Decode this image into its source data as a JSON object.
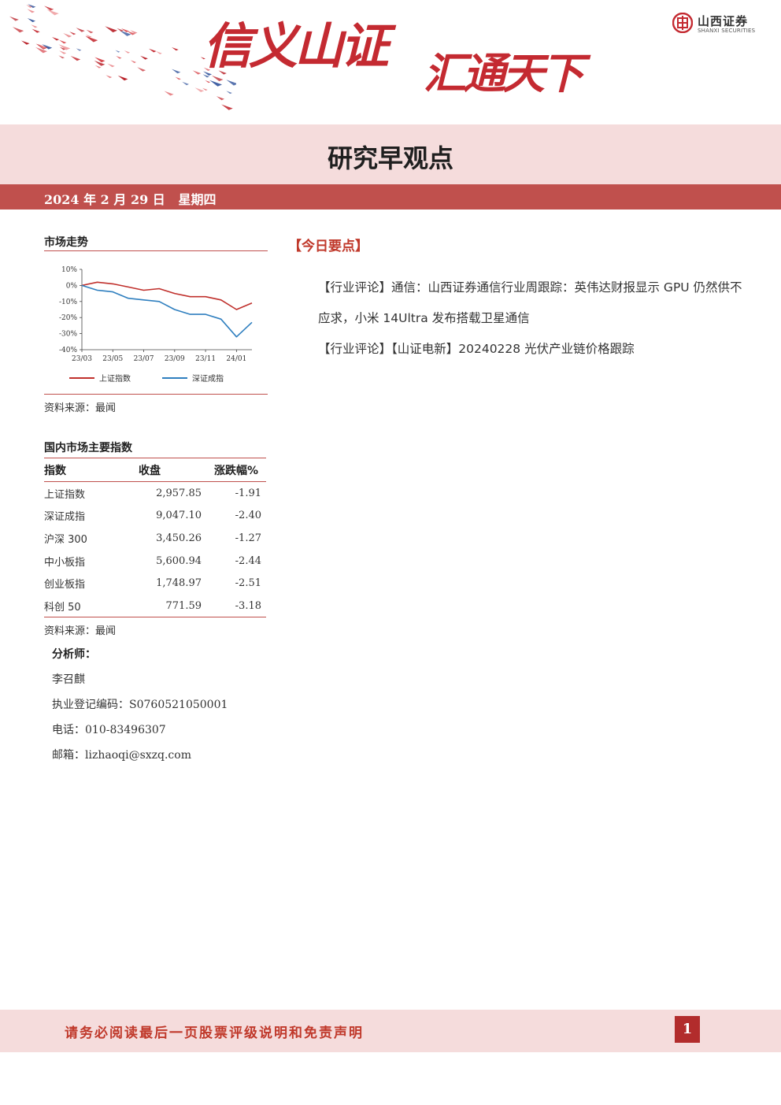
{
  "header": {
    "slogan_part1": "信义山证",
    "slogan_part2": "汇通天下",
    "logo_cn": "山西证券",
    "logo_en": "SHANXI SECURITIES",
    "report_title": "研究早观点",
    "date": "2024 年 2 月 29 日",
    "weekday": "星期四"
  },
  "market": {
    "heading": "市场走势",
    "source": "资料来源：最闻"
  },
  "chart_data": {
    "type": "line",
    "x": [
      "23/03",
      "23/04",
      "23/05",
      "23/06",
      "23/07",
      "23/08",
      "23/09",
      "23/10",
      "23/11",
      "23/12",
      "24/01",
      "24/02"
    ],
    "xticks": [
      "23/03",
      "23/05",
      "23/07",
      "23/09",
      "23/11",
      "24/01"
    ],
    "yticks": [
      "10%",
      "0%",
      "-10%",
      "-20%",
      "-30%",
      "-40%"
    ],
    "ylim": [
      -40,
      10
    ],
    "series": [
      {
        "name": "上证指数",
        "color": "#c0302c",
        "values": [
          0,
          2,
          1,
          -1,
          -3,
          -2,
          -5,
          -7,
          -7,
          -9,
          -15,
          -11
        ]
      },
      {
        "name": "深证成指",
        "color": "#2f7fbf",
        "values": [
          0,
          -3,
          -4,
          -8,
          -9,
          -10,
          -15,
          -18,
          -18,
          -21,
          -32,
          -23
        ]
      }
    ],
    "grid": false,
    "legend": "bottom"
  },
  "indices": {
    "heading": "国内市场主要指数",
    "columns": [
      "指数",
      "收盘",
      "涨跌幅%"
    ],
    "rows": [
      {
        "name": "上证指数",
        "close": "2,957.85",
        "chg": "-1.91"
      },
      {
        "name": "深证成指",
        "close": "9,047.10",
        "chg": "-2.40"
      },
      {
        "name": "沪深 300",
        "close": "3,450.26",
        "chg": "-1.27"
      },
      {
        "name": "中小板指",
        "close": "5,600.94",
        "chg": "-2.44"
      },
      {
        "name": "创业板指",
        "close": "1,748.97",
        "chg": "-2.51"
      },
      {
        "name": "科创 50",
        "close": "771.59",
        "chg": "-3.18"
      }
    ],
    "source": "资料来源：最闻"
  },
  "analyst": {
    "label": "分析师：",
    "name": "李召麒",
    "reg_label": "执业登记编码：",
    "reg_code": "S0760521050001",
    "phone_label": "电话：",
    "phone": "010-83496307",
    "email_label": "邮箱：",
    "email": "lizhaoqi@sxzq.com"
  },
  "today": {
    "heading": "【今日要点】",
    "point1": "【行业评论】通信：山西证券通信行业周跟踪：英伟达财报显示 GPU 仍然供不应求，小米 14Ultra 发布搭载卫星通信",
    "point2": "【行业评论】【山证电新】20240228 光伏产业链价格跟踪"
  },
  "footer": {
    "notice": "请务必阅读最后一页股票评级说明和免责声明",
    "page": "1"
  }
}
